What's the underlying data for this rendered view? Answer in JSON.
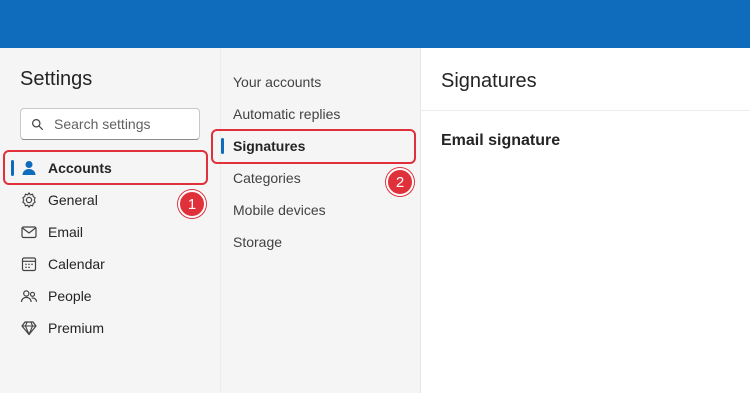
{
  "settings": {
    "title": "Settings",
    "search_placeholder": "Search settings",
    "nav": [
      {
        "label": "Accounts",
        "icon": "person-icon",
        "selected": true
      },
      {
        "label": "General",
        "icon": "gear-icon"
      },
      {
        "label": "Email",
        "icon": "mail-icon"
      },
      {
        "label": "Calendar",
        "icon": "calendar-icon"
      },
      {
        "label": "People",
        "icon": "people-icon"
      },
      {
        "label": "Premium",
        "icon": "diamond-icon"
      }
    ]
  },
  "accounts_menu": {
    "items": [
      {
        "label": "Your accounts"
      },
      {
        "label": "Automatic replies"
      },
      {
        "label": "Signatures",
        "selected": true
      },
      {
        "label": "Categories"
      },
      {
        "label": "Mobile devices"
      },
      {
        "label": "Storage"
      }
    ]
  },
  "content": {
    "title": "Signatures",
    "section_heading": "Email signature"
  },
  "annotations": [
    {
      "number": "1"
    },
    {
      "number": "2"
    }
  ],
  "colors": {
    "topbar": "#0f6cbd",
    "accent": "#0f6cbd",
    "annotation": "#e0313b"
  }
}
